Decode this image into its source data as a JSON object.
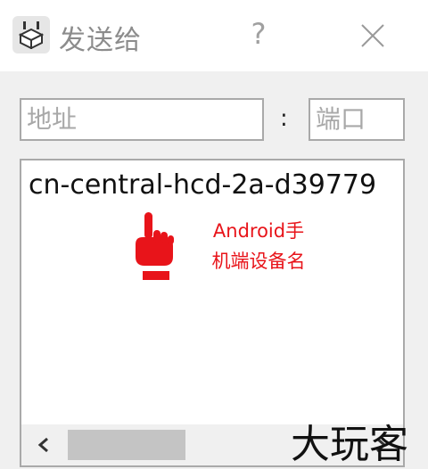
{
  "window": {
    "title": "发送给",
    "help_label": "?"
  },
  "form": {
    "address_placeholder": "地址",
    "separator": ":",
    "port_placeholder": "端口"
  },
  "devices": {
    "items": [
      "cn-central-hcd-2a-d39779"
    ]
  },
  "annotation": {
    "line1": "Android手",
    "line2": "机端设备名"
  },
  "watermark": "大玩客",
  "colors": {
    "annotation": "#e8141a",
    "background": "#f0f0f0"
  }
}
